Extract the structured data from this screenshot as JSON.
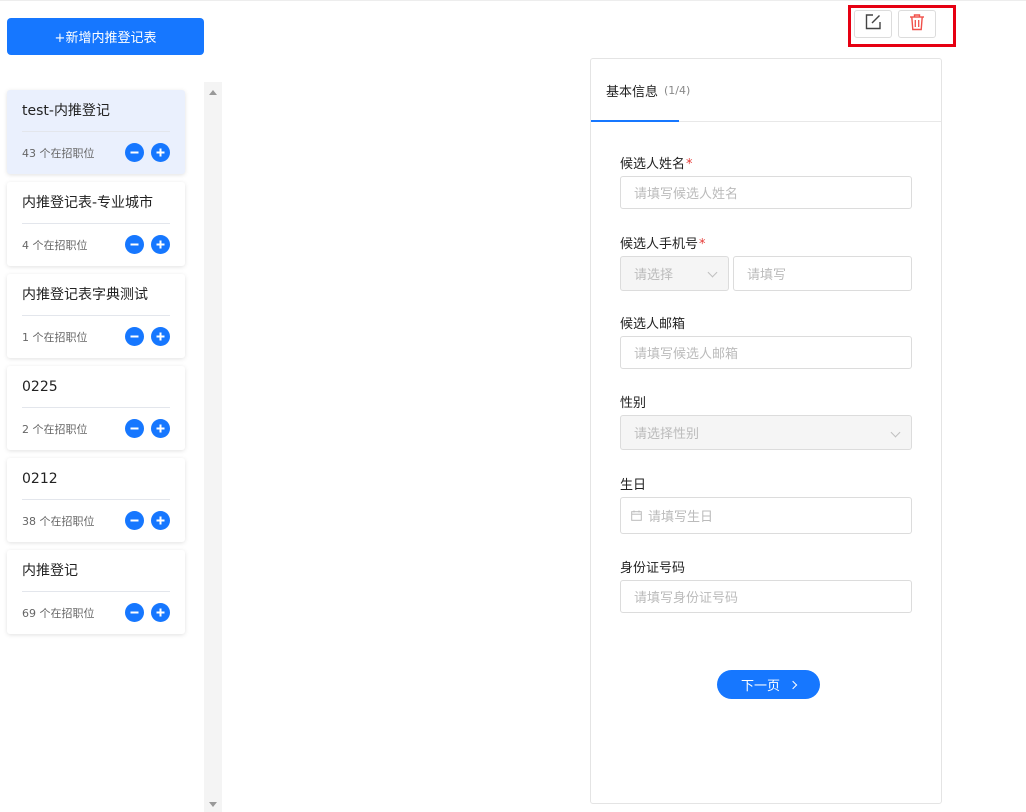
{
  "sidebar": {
    "add_button_label": "+新增内推登记表",
    "items": [
      {
        "title": "test-内推登记",
        "count": "43 个在招职位",
        "active": true
      },
      {
        "title": "内推登记表-专业城市",
        "count": "4 个在招职位",
        "active": false
      },
      {
        "title": "内推登记表字典测试",
        "count": "1 个在招职位",
        "active": false
      },
      {
        "title": "0225",
        "count": "2 个在招职位",
        "active": false
      },
      {
        "title": "0212",
        "count": "38 个在招职位",
        "active": false
      },
      {
        "title": "内推登记",
        "count": "69 个在招职位",
        "active": false
      }
    ]
  },
  "toolbar": {
    "edit_icon": "edit-square-icon",
    "delete_icon": "trash-icon",
    "delete_color": "#f0504a",
    "highlight_color": "#e60012"
  },
  "form": {
    "tab": {
      "label": "基本信息",
      "step": "(1/4)"
    },
    "fields": {
      "name": {
        "label": "候选人姓名",
        "required": "*",
        "placeholder": "请填写候选人姓名"
      },
      "phone": {
        "label": "候选人手机号",
        "required": "*",
        "code_placeholder": "请选择",
        "placeholder": "请填写"
      },
      "email": {
        "label": "候选人邮箱",
        "placeholder": "请填写候选人邮箱"
      },
      "gender": {
        "label": "性别",
        "placeholder": "请选择性别"
      },
      "birthday": {
        "label": "生日",
        "placeholder": "请填写生日"
      },
      "id_number": {
        "label": "身份证号码",
        "placeholder": "请填写身份证号码"
      }
    },
    "next_label": "下一页"
  },
  "colors": {
    "primary": "#1677ff",
    "required": "#e53935"
  }
}
